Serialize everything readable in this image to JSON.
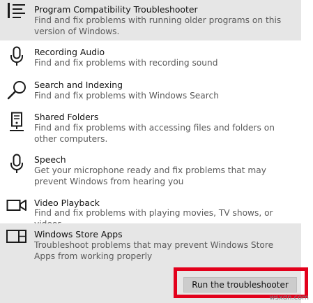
{
  "items": [
    {
      "title": "Program Compatibility Troubleshooter",
      "desc": "Find and fix problems with running older programs on this version of Windows.",
      "icon": "list-icon"
    },
    {
      "title": "Recording Audio",
      "desc": "Find and fix problems with recording sound",
      "icon": "microphone-icon"
    },
    {
      "title": "Search and Indexing",
      "desc": "Find and fix problems with Windows Search",
      "icon": "search-icon"
    },
    {
      "title": "Shared Folders",
      "desc": "Find and fix problems with accessing files and folders on other computers.",
      "icon": "shared-folders-icon"
    },
    {
      "title": "Speech",
      "desc": "Get your microphone ready and fix problems that may prevent Windows from hearing you",
      "icon": "microphone-icon"
    },
    {
      "title": "Video Playback",
      "desc": "Find and fix problems with playing movies, TV shows, or videos",
      "icon": "video-camera-icon"
    },
    {
      "title": "Windows Store Apps",
      "desc": "Troubleshoot problems that may prevent Windows Store Apps from working properly",
      "icon": "store-apps-icon"
    }
  ],
  "run_button": "Run the troubleshooter",
  "watermark": "wsxdn.com",
  "colors": {
    "highlight": "#e6e6e6",
    "red_frame": "#e3001b",
    "button": "#cccccc"
  }
}
